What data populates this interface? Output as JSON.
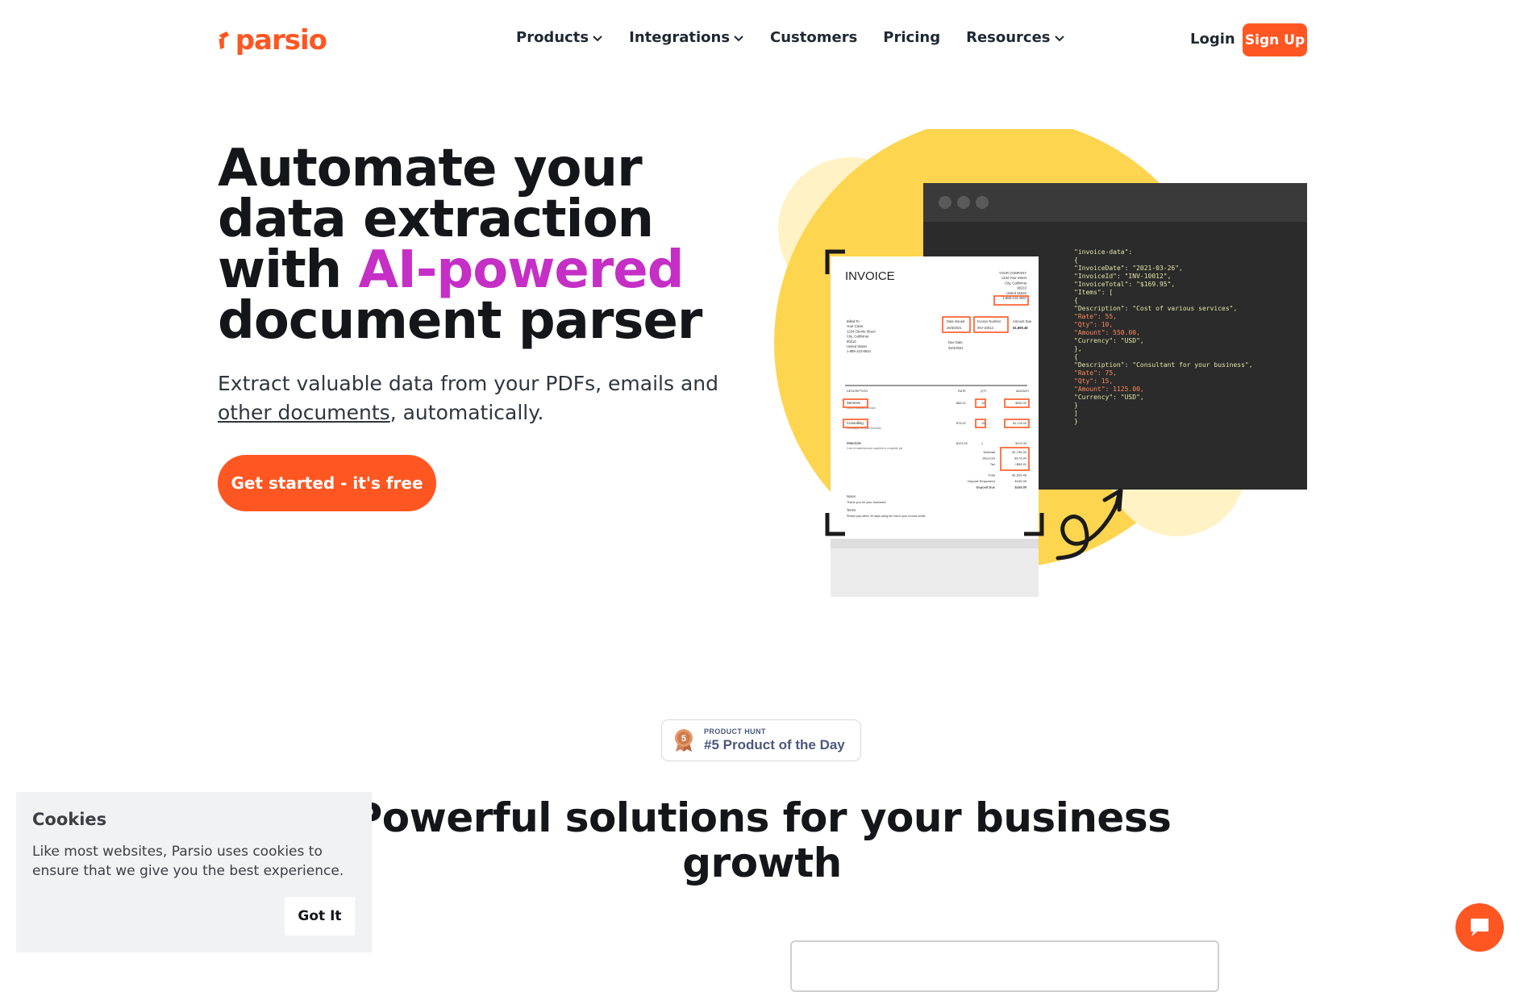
{
  "brand": {
    "name": "parsio",
    "color": "#ff5622",
    "accent": "#c52fc6"
  },
  "nav": {
    "items": [
      {
        "label": "Products",
        "dropdown": true
      },
      {
        "label": "Integrations",
        "dropdown": true
      },
      {
        "label": "Customers",
        "dropdown": false
      },
      {
        "label": "Pricing",
        "dropdown": false
      },
      {
        "label": "Resources",
        "dropdown": true
      }
    ],
    "login": "Login",
    "signup": "Sign Up"
  },
  "hero": {
    "title_line1": "Automate your",
    "title_line2": "data extraction",
    "title_line3_pre": "with ",
    "title_line3_accent": "AI-powered",
    "title_line4": "document parser",
    "subtitle_pre": "Extract valuable data from your PDFs, emails and ",
    "subtitle_link": "other documents",
    "subtitle_post": ", automatically.",
    "cta": "Get started - it's free"
  },
  "illustration": {
    "invoice": {
      "title": "INVOICE",
      "company": [
        "YOUR COMPANY",
        "1234 Your Street",
        "City, California",
        "90210",
        "United States",
        "1-888-123-4567"
      ],
      "billed_to": [
        "Billed To",
        "Your Client",
        "1234 Clients Street",
        "City, California",
        "90210",
        "United States",
        "1-888-123-8910"
      ],
      "meta_labels": [
        "Date Issued",
        "Invoice Number",
        "Amount Due"
      ],
      "meta_values": [
        "26/3/2021",
        "INV-10012",
        "$1,699.48"
      ],
      "due_label": "Due Date",
      "due_value": "25/4/2021",
      "table_headers": [
        "DESCRIPTION",
        "RATE",
        "QTY",
        "AMOUNT"
      ],
      "rows": [
        {
          "desc": "Services",
          "note": "Cost of various services",
          "rate": "$55.00",
          "qty": "10",
          "amount": "$550.00"
        },
        {
          "desc": "Consulting",
          "note": "Consultant for your business",
          "rate": "$75.00",
          "qty": "15",
          "amount": "$1,125.00"
        },
        {
          "desc": "Materials",
          "note": "Cost of materials and supplies to complete job",
          "rate": "$123.39",
          "qty": "1",
          "amount": "$123.39"
        }
      ],
      "totals_labels": [
        "Subtotal",
        "Discount",
        "Tax",
        "Total",
        "Deposit Requested",
        "Deposit Due"
      ],
      "totals_values": [
        "$1,798.39",
        "-$173.94",
        "+$80.91",
        "$1,699.48",
        "$169.95",
        "$169.95"
      ],
      "notes_label": "Notes",
      "notes_text": "Thank you for your business!",
      "terms_label": "Terms",
      "terms_text": "Please pay within 30 days using the link in your invoice email."
    },
    "code_lines": [
      "\"invoice-data\":",
      "{",
      "  \"InvoiceDate\": \"2021-03-26\",",
      "  \"InvoiceId\": \"INV-10012\",",
      "  \"InvoiceTotal\": \"$169.95\",",
      "  \"Items\": [",
      "   {",
      "    \"Description\": \"Cost of various services\",",
      "    \"Rate\": 55,",
      "    \"Qty\": 10,",
      "    \"Amount\": 550.00,",
      "    \"Currency\": \"USD\",",
      "   },",
      "   {",
      "    \"Description\": \"Consultant for your business\",",
      "    \"Rate\": 75,",
      "    \"Qty\": 15,",
      "    \"Amount\": 1125.00,",
      "    \"Currency\": \"USD\",",
      "   }",
      "  ]",
      "}"
    ]
  },
  "product_hunt": {
    "small": "PRODUCT HUNT",
    "big": "#5 Product of the Day",
    "rank": "5"
  },
  "section": {
    "title_line1": "Powerful solutions for your business",
    "title_line2": "growth"
  },
  "cookies": {
    "title": "Cookies",
    "text": "Like most websites, Parsio uses cookies to ensure that we give you the best experience.",
    "button": "Got It"
  },
  "chat": {
    "icon": "chat-bubble-icon"
  }
}
